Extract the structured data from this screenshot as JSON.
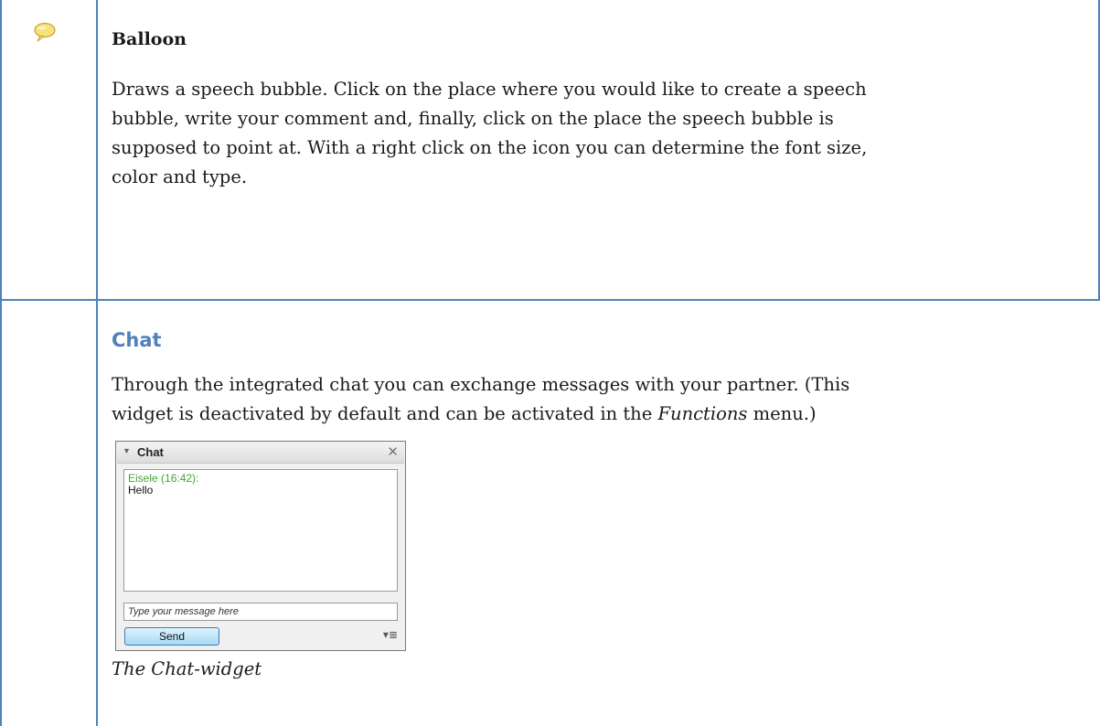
{
  "balloon": {
    "icon": "speech-balloon-icon",
    "heading": "Balloon",
    "lines": [
      "Draws a speech bubble. Click on the place where you would like to create a speech",
      "bubble, write your comment and, finally, click on the place the speech bubble is",
      "supposed to point at.  With a right click on the icon you can determine the font size,",
      "color and type."
    ]
  },
  "chat": {
    "heading": "Chat",
    "line1": "Through the integrated chat you can exchange messages with your partner. (This",
    "line2_before": "widget is deactivated by default and can be activated in the ",
    "line2_em": "Functions",
    "line2_after": " menu.)",
    "widget": {
      "title": "Chat",
      "collapse_icon": "collapse-triangle-icon",
      "close_icon": "close-icon",
      "sender": "Eisele (16:42):",
      "message": "Hello",
      "input_placeholder": "Type your message here",
      "send_label": "Send",
      "options_icon": "options-menu-icon"
    },
    "caption": "The Chat-widget"
  },
  "colors": {
    "border": "#4f81bd",
    "heading_accent": "#4f81bd",
    "sender": "#4aa13a"
  }
}
